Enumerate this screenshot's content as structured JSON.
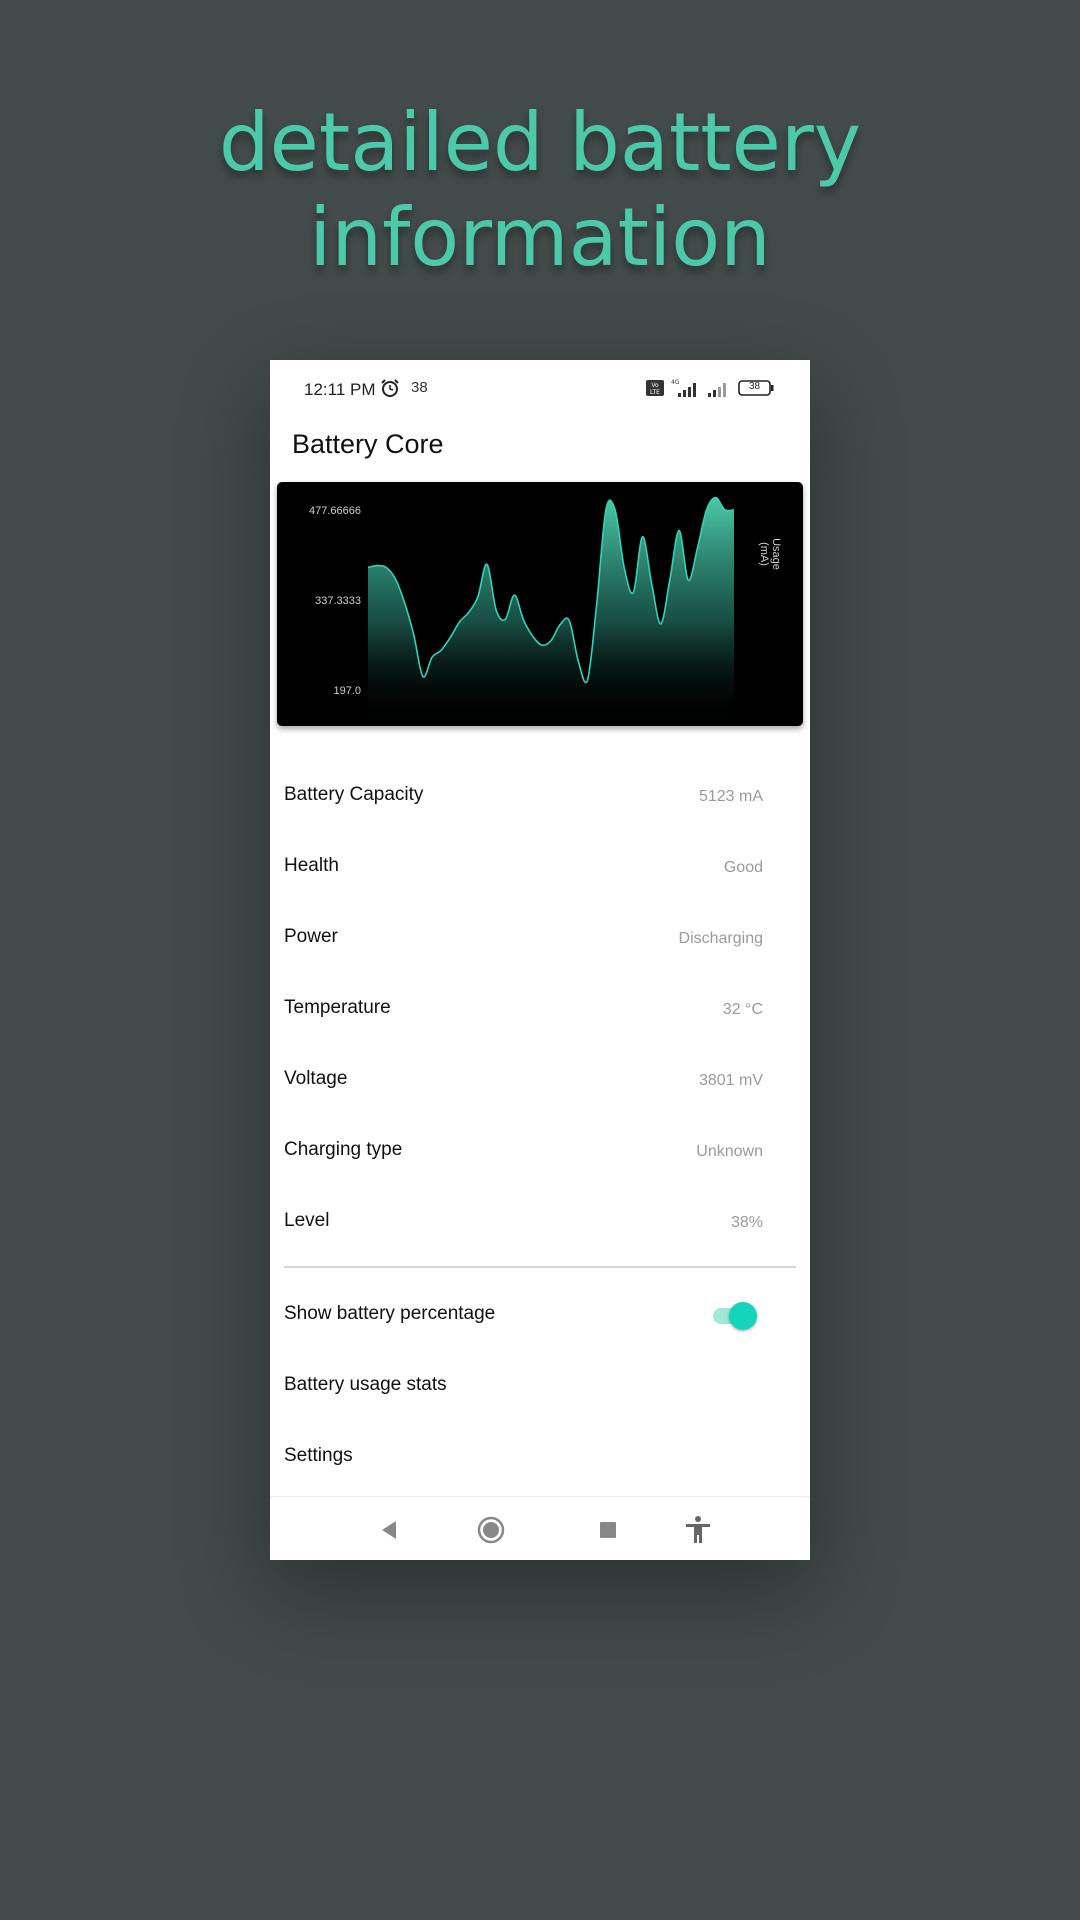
{
  "headline": {
    "line1": "detailed battery",
    "line2": "information"
  },
  "status_bar": {
    "time": "12:11 PM",
    "notification_count": "38",
    "battery_level": "38",
    "icons": [
      "alarm-icon",
      "volte-icon",
      "signal-4g-icon",
      "signal-icon",
      "battery-icon"
    ]
  },
  "app": {
    "title": "Battery Core"
  },
  "chart_data": {
    "type": "area",
    "ylabel": "Usage\n(mA)",
    "ylabel_lines": [
      "Usage",
      "(mA)"
    ],
    "ytick_labels": [
      "477.66666",
      "337.3333",
      "197.0"
    ],
    "ylim": [
      197.0,
      477.66666
    ],
    "x": [
      0,
      1,
      2,
      3,
      4,
      5,
      6,
      7,
      8,
      9,
      10,
      11,
      12,
      13,
      14,
      15,
      16,
      17,
      18,
      19,
      20,
      21,
      22,
      23,
      24,
      25,
      26,
      27,
      28,
      29,
      30,
      31,
      32,
      33,
      34,
      35,
      36,
      37,
      38,
      39,
      40,
      41,
      42,
      43,
      44,
      45,
      46,
      47,
      48,
      49,
      50,
      51,
      52,
      53,
      54,
      55,
      56,
      57,
      58,
      59,
      60
    ],
    "values": [
      388,
      391,
      388,
      370,
      333,
      283,
      218,
      248,
      259,
      279,
      303,
      318,
      342,
      393,
      322,
      307,
      345,
      306,
      281,
      267,
      274,
      299,
      305,
      241,
      213,
      332,
      478,
      478,
      388,
      349,
      436,
      363,
      300,
      370,
      446,
      368,
      418,
      478,
      497,
      478,
      478
    ],
    "colors": {
      "line": "#2ed3bd",
      "fill_top": "#4cc9a8",
      "background": "#000000",
      "tick_text": "#cfcfcf"
    },
    "grid": false
  },
  "info_rows": [
    {
      "label": "Battery Capacity",
      "value": "5123 mA"
    },
    {
      "label": "Health",
      "value": "Good"
    },
    {
      "label": "Power",
      "value": "Discharging"
    },
    {
      "label": "Temperature",
      "value": "32 °C"
    },
    {
      "label": "Voltage",
      "value": "3801 mV"
    },
    {
      "label": "Charging type",
      "value": "Unknown"
    },
    {
      "label": "Level",
      "value": "38%"
    }
  ],
  "settings": {
    "show_percentage": {
      "label": "Show battery percentage",
      "enabled": true
    },
    "usage_stats": {
      "label": "Battery usage stats"
    },
    "settings": {
      "label": "Settings"
    }
  },
  "navigation": {
    "icons": [
      "back-icon",
      "home-icon",
      "recents-icon",
      "accessibility-icon"
    ]
  },
  "colors": {
    "accent": "#4cc9a8",
    "toggle": "#14d5bc",
    "page_background": "#424b4a"
  }
}
